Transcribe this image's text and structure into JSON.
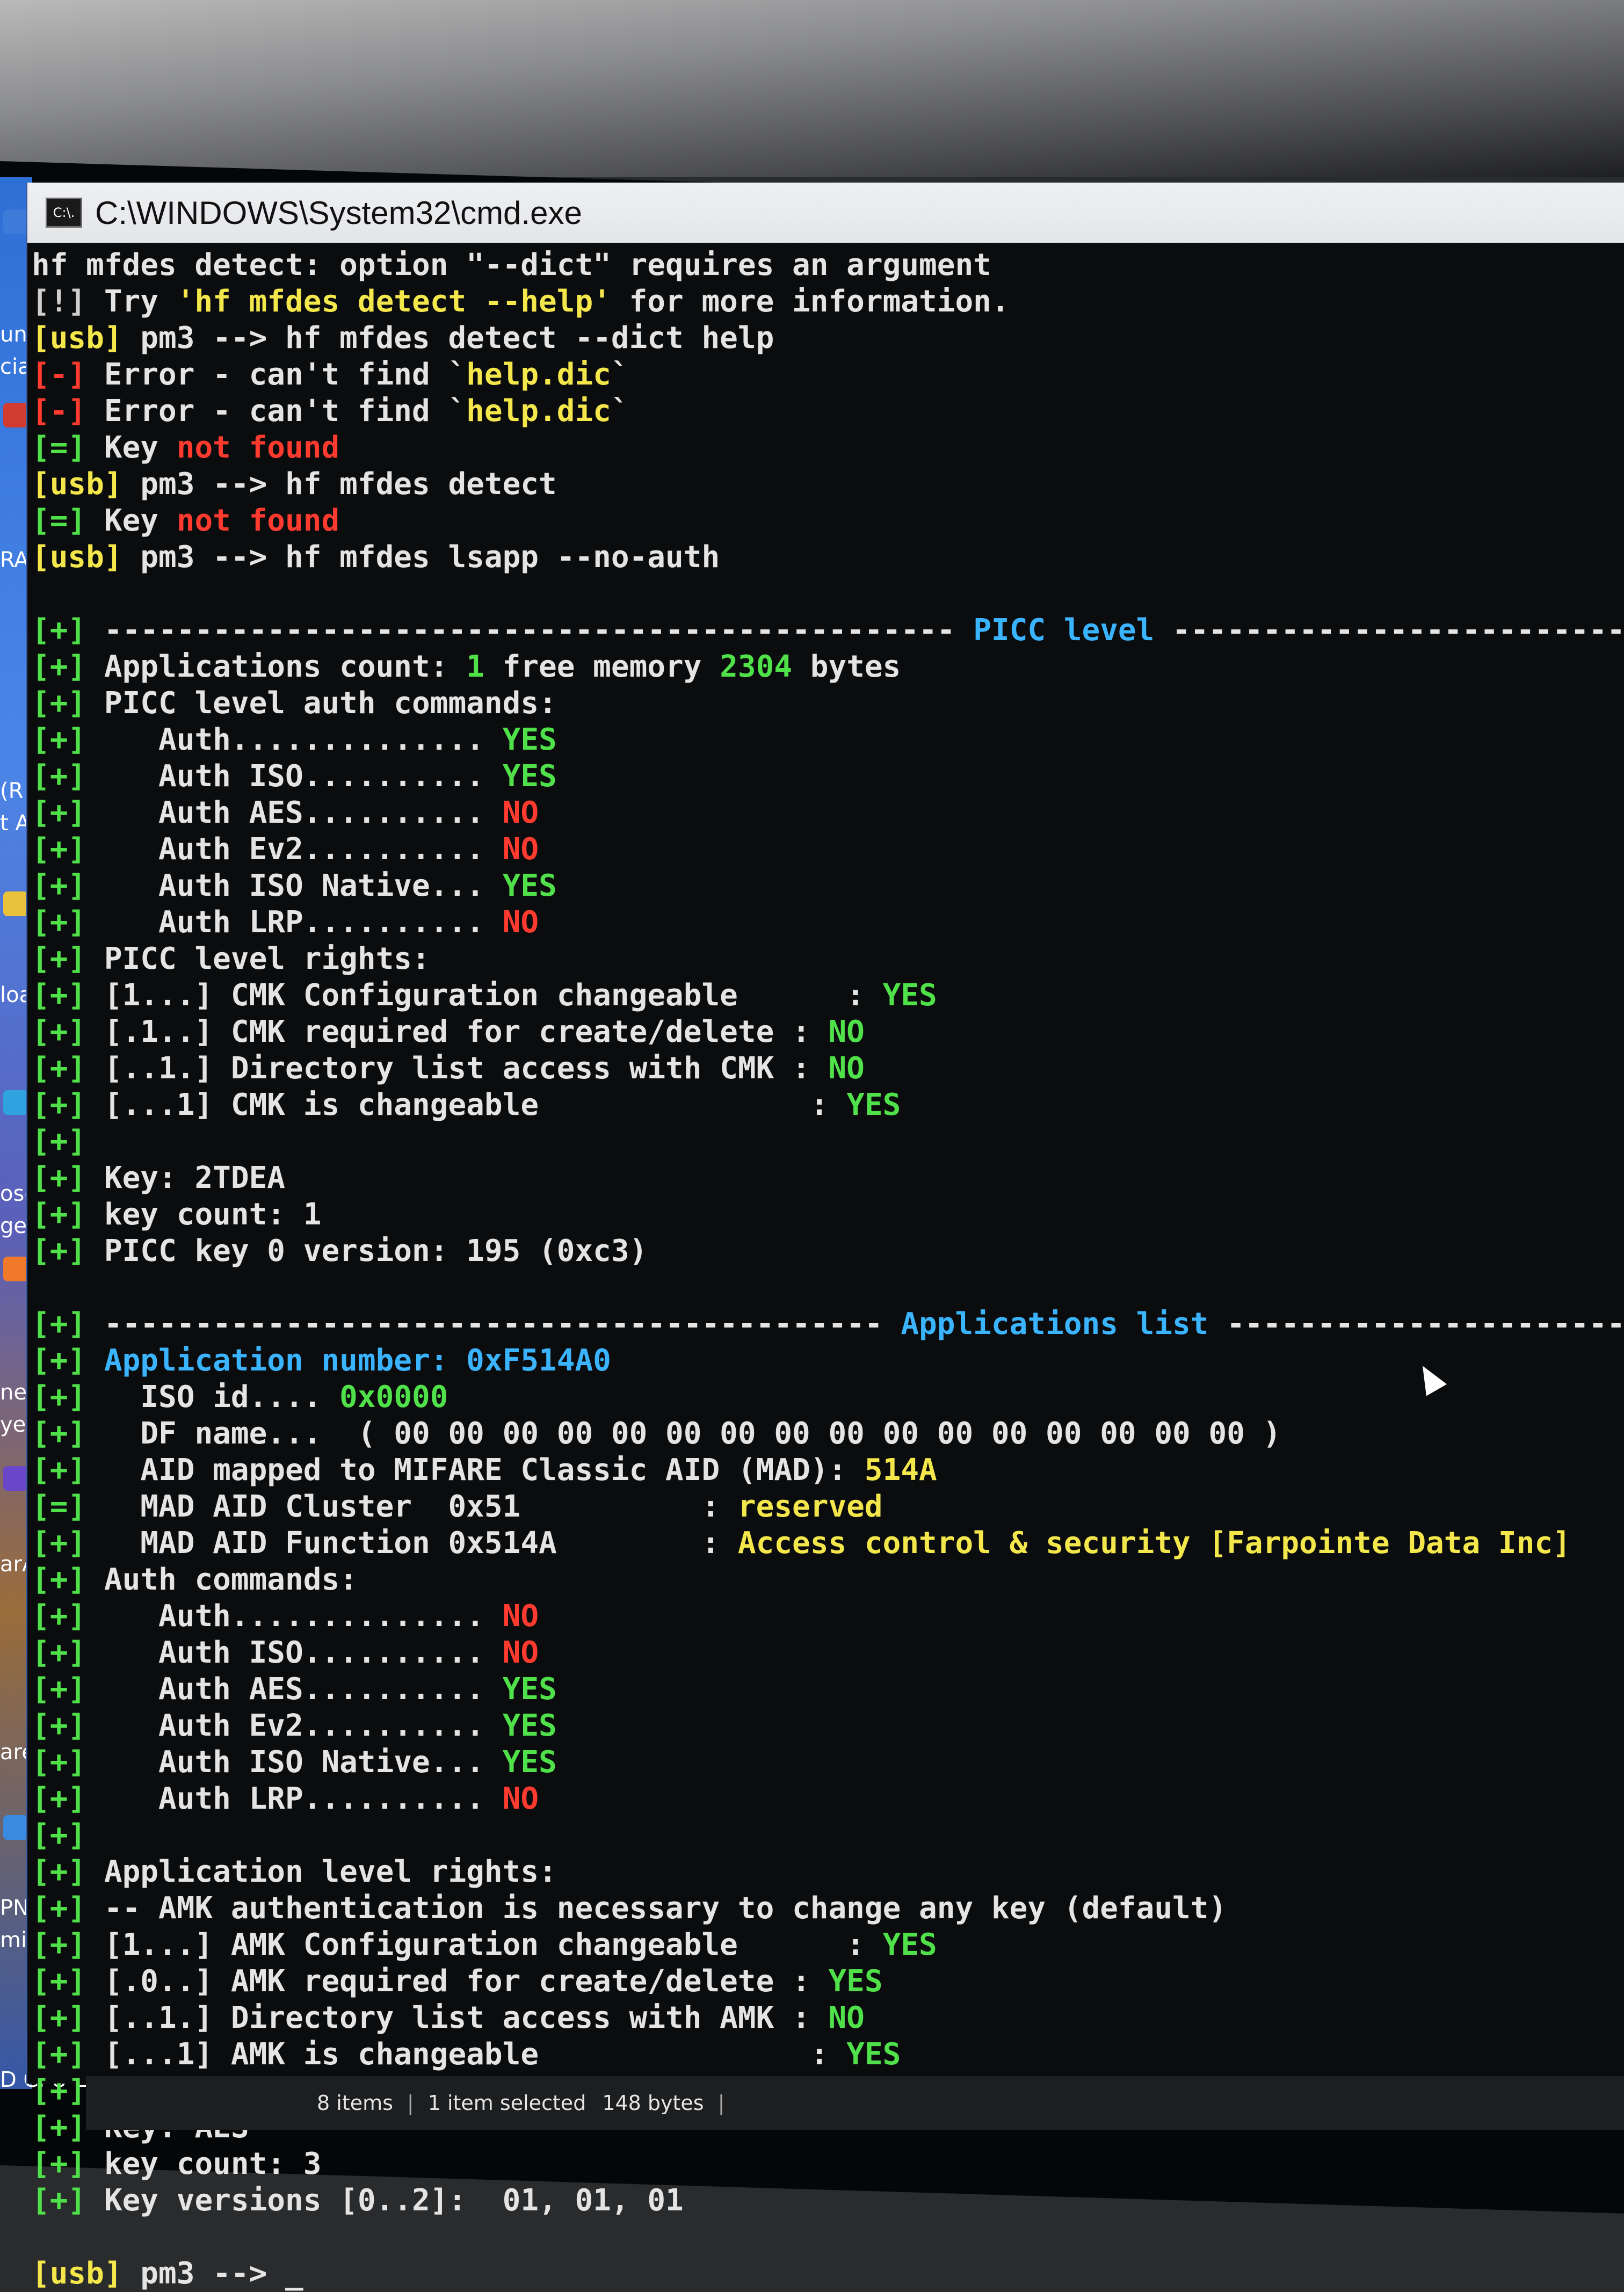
{
  "window": {
    "title": "C:\\WINDOWS\\System32\\cmd.exe",
    "icon_label": "C:\\."
  },
  "desktop_labels": [
    "un",
    "cia",
    "RA",
    "(R",
    "t A",
    "loa",
    "osc",
    "ge",
    "nec",
    "yer",
    "arA",
    "areb",
    "PN",
    "mit",
    "D CPU-Z"
  ],
  "terminal": {
    "lines": [
      [
        {
          "t": "hf mfdes detect: option \"--dict\" requires an argument",
          "c": "wh"
        }
      ],
      [
        {
          "t": "[!] ",
          "c": "dim"
        },
        {
          "t": "Try ",
          "c": "wh"
        },
        {
          "t": "'hf mfdes detect --help'",
          "c": "ye"
        },
        {
          "t": " for more information.",
          "c": "wh"
        }
      ],
      [
        {
          "t": "[usb]",
          "c": "ye"
        },
        {
          "t": " pm3 --> hf mfdes detect --dict help",
          "c": "wh"
        }
      ],
      [
        {
          "t": "[-]",
          "c": "rd"
        },
        {
          "t": " Error - can't find `",
          "c": "wh"
        },
        {
          "t": "help.dic",
          "c": "ye"
        },
        {
          "t": "`",
          "c": "wh"
        }
      ],
      [
        {
          "t": "[-]",
          "c": "rd"
        },
        {
          "t": " Error - can't find `",
          "c": "wh"
        },
        {
          "t": "help.dic",
          "c": "ye"
        },
        {
          "t": "`",
          "c": "wh"
        }
      ],
      [
        {
          "t": "[=]",
          "c": "gr"
        },
        {
          "t": " Key ",
          "c": "wh"
        },
        {
          "t": "not found",
          "c": "rd"
        }
      ],
      [
        {
          "t": "[usb]",
          "c": "ye"
        },
        {
          "t": " pm3 --> hf mfdes detect",
          "c": "wh"
        }
      ],
      [
        {
          "t": "[=]",
          "c": "gr"
        },
        {
          "t": " Key ",
          "c": "wh"
        },
        {
          "t": "not found",
          "c": "rd"
        }
      ],
      [
        {
          "t": "[usb]",
          "c": "ye"
        },
        {
          "t": " pm3 --> hf mfdes lsapp --no-auth",
          "c": "wh"
        }
      ],
      [
        {
          "t": "",
          "c": "wh"
        }
      ],
      [
        {
          "t": "[+]",
          "c": "gr"
        },
        {
          "t": " ----------------------------------------------- ",
          "c": "wh"
        },
        {
          "t": "PICC level",
          "c": "cy"
        },
        {
          "t": " -------------------------------------------------",
          "c": "wh"
        }
      ],
      [
        {
          "t": "[+]",
          "c": "gr"
        },
        {
          "t": " Applications count: ",
          "c": "wh"
        },
        {
          "t": "1",
          "c": "gr"
        },
        {
          "t": " free memory ",
          "c": "wh"
        },
        {
          "t": "2304",
          "c": "gr"
        },
        {
          "t": " bytes",
          "c": "wh"
        }
      ],
      [
        {
          "t": "[+]",
          "c": "gr"
        },
        {
          "t": " PICC level auth commands:",
          "c": "wh"
        }
      ],
      [
        {
          "t": "[+]",
          "c": "gr"
        },
        {
          "t": "    Auth.............. ",
          "c": "wh"
        },
        {
          "t": "YES",
          "c": "gr"
        }
      ],
      [
        {
          "t": "[+]",
          "c": "gr"
        },
        {
          "t": "    Auth ISO.......... ",
          "c": "wh"
        },
        {
          "t": "YES",
          "c": "gr"
        }
      ],
      [
        {
          "t": "[+]",
          "c": "gr"
        },
        {
          "t": "    Auth AES.......... ",
          "c": "wh"
        },
        {
          "t": "NO",
          "c": "rd"
        }
      ],
      [
        {
          "t": "[+]",
          "c": "gr"
        },
        {
          "t": "    Auth Ev2.......... ",
          "c": "wh"
        },
        {
          "t": "NO",
          "c": "rd"
        }
      ],
      [
        {
          "t": "[+]",
          "c": "gr"
        },
        {
          "t": "    Auth ISO Native... ",
          "c": "wh"
        },
        {
          "t": "YES",
          "c": "gr"
        }
      ],
      [
        {
          "t": "[+]",
          "c": "gr"
        },
        {
          "t": "    Auth LRP.......... ",
          "c": "wh"
        },
        {
          "t": "NO",
          "c": "rd"
        }
      ],
      [
        {
          "t": "[+]",
          "c": "gr"
        },
        {
          "t": " PICC level rights:",
          "c": "wh"
        }
      ],
      [
        {
          "t": "[+]",
          "c": "gr"
        },
        {
          "t": " [1...] CMK Configuration changeable      : ",
          "c": "wh"
        },
        {
          "t": "YES",
          "c": "gr"
        }
      ],
      [
        {
          "t": "[+]",
          "c": "gr"
        },
        {
          "t": " [.1..] CMK required for create/delete : ",
          "c": "wh"
        },
        {
          "t": "NO",
          "c": "gr"
        }
      ],
      [
        {
          "t": "[+]",
          "c": "gr"
        },
        {
          "t": " [..1.] Directory list access with CMK : ",
          "c": "wh"
        },
        {
          "t": "NO",
          "c": "gr"
        }
      ],
      [
        {
          "t": "[+]",
          "c": "gr"
        },
        {
          "t": " [...1] CMK is changeable               : ",
          "c": "wh"
        },
        {
          "t": "YES",
          "c": "gr"
        }
      ],
      [
        {
          "t": "[+]",
          "c": "gr"
        }
      ],
      [
        {
          "t": "[+]",
          "c": "gr"
        },
        {
          "t": " Key: 2TDEA",
          "c": "wh"
        }
      ],
      [
        {
          "t": "[+]",
          "c": "gr"
        },
        {
          "t": " key count: 1",
          "c": "wh"
        }
      ],
      [
        {
          "t": "[+]",
          "c": "gr"
        },
        {
          "t": " PICC key 0 version: 195 (0xc3)",
          "c": "wh"
        }
      ],
      [
        {
          "t": "",
          "c": "wh"
        }
      ],
      [
        {
          "t": "[+]",
          "c": "gr"
        },
        {
          "t": " ------------------------------------------- ",
          "c": "wh"
        },
        {
          "t": "Applications list",
          "c": "cy"
        },
        {
          "t": " --------------------------------------",
          "c": "wh"
        }
      ],
      [
        {
          "t": "[+]",
          "c": "gr"
        },
        {
          "t": " Application number: 0xF514A0",
          "c": "cy"
        }
      ],
      [
        {
          "t": "[+]",
          "c": "gr"
        },
        {
          "t": "   ISO id.... ",
          "c": "wh"
        },
        {
          "t": "0x0000",
          "c": "gr"
        }
      ],
      [
        {
          "t": "[+]",
          "c": "gr"
        },
        {
          "t": "   DF name...  ( 00 00 00 00 00 00 00 00 00 00 00 00 00 00 00 00 )",
          "c": "wh"
        }
      ],
      [
        {
          "t": "[+]",
          "c": "gr"
        },
        {
          "t": "   AID mapped to MIFARE Classic AID (MAD): ",
          "c": "wh"
        },
        {
          "t": "514A",
          "c": "ye"
        }
      ],
      [
        {
          "t": "[=]",
          "c": "gr"
        },
        {
          "t": "   MAD AID Cluster  0x51          : ",
          "c": "wh"
        },
        {
          "t": "reserved",
          "c": "ye"
        }
      ],
      [
        {
          "t": "[+]",
          "c": "gr"
        },
        {
          "t": "   MAD AID Function 0x514A        : ",
          "c": "wh"
        },
        {
          "t": "Access control & security [Farpointe Data Inc]",
          "c": "ye"
        }
      ],
      [
        {
          "t": "[+]",
          "c": "gr"
        },
        {
          "t": " Auth commands:",
          "c": "wh"
        }
      ],
      [
        {
          "t": "[+]",
          "c": "gr"
        },
        {
          "t": "    Auth.............. ",
          "c": "wh"
        },
        {
          "t": "NO",
          "c": "rd"
        }
      ],
      [
        {
          "t": "[+]",
          "c": "gr"
        },
        {
          "t": "    Auth ISO.......... ",
          "c": "wh"
        },
        {
          "t": "NO",
          "c": "rd"
        }
      ],
      [
        {
          "t": "[+]",
          "c": "gr"
        },
        {
          "t": "    Auth AES.......... ",
          "c": "wh"
        },
        {
          "t": "YES",
          "c": "gr"
        }
      ],
      [
        {
          "t": "[+]",
          "c": "gr"
        },
        {
          "t": "    Auth Ev2.......... ",
          "c": "wh"
        },
        {
          "t": "YES",
          "c": "gr"
        }
      ],
      [
        {
          "t": "[+]",
          "c": "gr"
        },
        {
          "t": "    Auth ISO Native... ",
          "c": "wh"
        },
        {
          "t": "YES",
          "c": "gr"
        }
      ],
      [
        {
          "t": "[+]",
          "c": "gr"
        },
        {
          "t": "    Auth LRP.......... ",
          "c": "wh"
        },
        {
          "t": "NO",
          "c": "rd"
        }
      ],
      [
        {
          "t": "[+]",
          "c": "gr"
        }
      ],
      [
        {
          "t": "[+]",
          "c": "gr"
        },
        {
          "t": " Application level rights:",
          "c": "wh"
        }
      ],
      [
        {
          "t": "[+]",
          "c": "gr"
        },
        {
          "t": " -- AMK authentication is necessary to change any key (default)",
          "c": "wh"
        }
      ],
      [
        {
          "t": "[+]",
          "c": "gr"
        },
        {
          "t": " [1...] AMK Configuration changeable      : ",
          "c": "wh"
        },
        {
          "t": "YES",
          "c": "gr"
        }
      ],
      [
        {
          "t": "[+]",
          "c": "gr"
        },
        {
          "t": " [.0..] AMK required for create/delete : ",
          "c": "wh"
        },
        {
          "t": "YES",
          "c": "gr"
        }
      ],
      [
        {
          "t": "[+]",
          "c": "gr"
        },
        {
          "t": " [..1.] Directory list access with AMK : ",
          "c": "wh"
        },
        {
          "t": "NO",
          "c": "gr"
        }
      ],
      [
        {
          "t": "[+]",
          "c": "gr"
        },
        {
          "t": " [...1] AMK is changeable               : ",
          "c": "wh"
        },
        {
          "t": "YES",
          "c": "gr"
        }
      ],
      [
        {
          "t": "[+]",
          "c": "gr"
        }
      ],
      [
        {
          "t": "[+]",
          "c": "gr"
        },
        {
          "t": " Key: AES",
          "c": "wh"
        }
      ],
      [
        {
          "t": "[+]",
          "c": "gr"
        },
        {
          "t": " key count: 3",
          "c": "wh"
        }
      ],
      [
        {
          "t": "[+]",
          "c": "gr"
        },
        {
          "t": " Key versions [0..2]:  01, 01, 01",
          "c": "wh"
        }
      ],
      [
        {
          "t": "",
          "c": "wh"
        }
      ],
      [
        {
          "t": "[usb]",
          "c": "ye"
        },
        {
          "t": " pm3 --> _",
          "c": "wh"
        }
      ]
    ]
  },
  "explorer_status": {
    "items": "8 items",
    "selected": "1 item selected",
    "size": "148 bytes"
  },
  "colors": {
    "prompt_yellow": "#f4e74b",
    "ok_green": "#4fe04a",
    "error_red": "#ff3b30",
    "heading_cyan": "#3bb4ff",
    "console_bg": "#0b0c0d"
  }
}
